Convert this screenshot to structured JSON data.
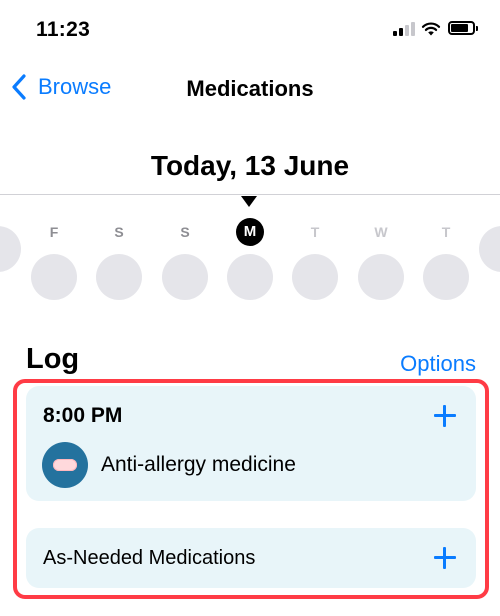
{
  "status_bar": {
    "time": "11:23"
  },
  "nav": {
    "back_label": "Browse",
    "title": "Medications"
  },
  "date_heading": "Today, 13 June",
  "week": {
    "days": [
      {
        "letter": "F",
        "state": "past"
      },
      {
        "letter": "S",
        "state": "past"
      },
      {
        "letter": "S",
        "state": "past"
      },
      {
        "letter": "M",
        "state": "today"
      },
      {
        "letter": "T",
        "state": "future"
      },
      {
        "letter": "W",
        "state": "future"
      },
      {
        "letter": "T",
        "state": "future"
      }
    ]
  },
  "log": {
    "title": "Log",
    "options_label": "Options",
    "scheduled": {
      "time": "8:00 PM",
      "medications": [
        {
          "name": "Anti-allergy medicine",
          "icon": "pill-icon"
        }
      ]
    },
    "as_needed_label": "As-Needed Medications"
  },
  "colors": {
    "accent": "#0a7cff",
    "card_background": "#e8f5f9",
    "highlight_border": "#ff3b45",
    "day_circle": "#e5e5ea",
    "pill_icon_background": "#24729e"
  }
}
